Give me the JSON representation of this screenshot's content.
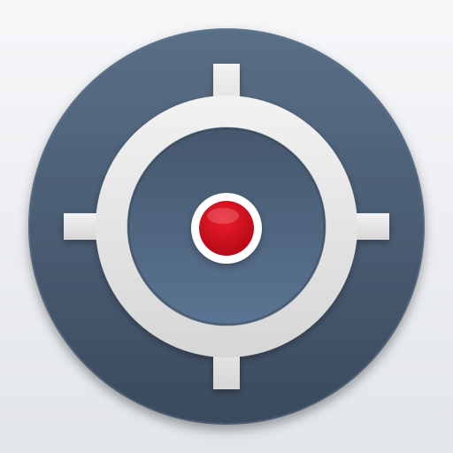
{
  "app_icon": {
    "name": "crosshair-target-icon",
    "colors": {
      "background_top": "#f6f7f9",
      "background_bottom": "#e2e5ea",
      "outer_disc_light": "#596f88",
      "outer_disc_dark": "#3b4a5d",
      "ring_light": "#f2f2f2",
      "ring_dark": "#d6d6d6",
      "inner_disc_top": "#45576d",
      "inner_disc_bottom": "#5a7491",
      "dot_red_light": "#ef1c2c",
      "dot_red_dark": "#b00814",
      "dot_border": "#ffffff"
    }
  }
}
